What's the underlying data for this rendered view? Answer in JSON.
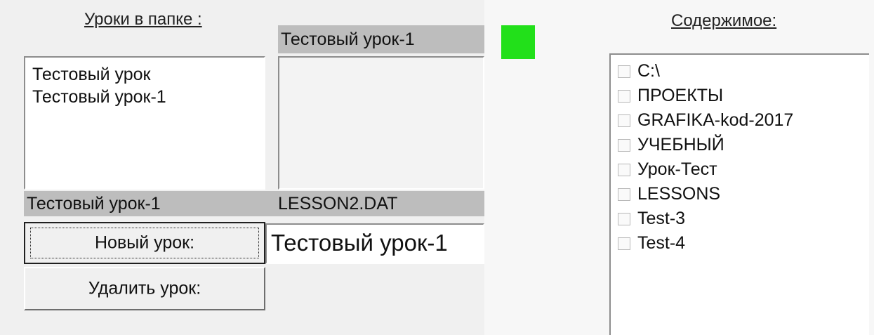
{
  "lessons_panel": {
    "header": "Уроки в папке :",
    "items": [
      "Тестовый урок",
      "Тестовый урок-1"
    ],
    "selected_name": "Тестовый урок-1"
  },
  "preview_panel": {
    "title_bar": "Тестовый урок-1",
    "file_bar": "LESSON2.DAT"
  },
  "buttons": {
    "new_lesson": "Новый урок:",
    "delete_lesson": "Удалить урок:"
  },
  "lesson_name_field": {
    "value": "Тестовый урок-1"
  },
  "status_indicator": {
    "color": "#22e01a"
  },
  "contents_panel": {
    "header": "Содержимое:",
    "items": [
      "C:\\",
      "ПРОЕКТЫ",
      "GRAFIKA-kod-2017",
      "УЧЕБНЫЙ",
      "Урок-Тест",
      "LESSONS",
      "Test-3",
      "Test-4"
    ]
  }
}
